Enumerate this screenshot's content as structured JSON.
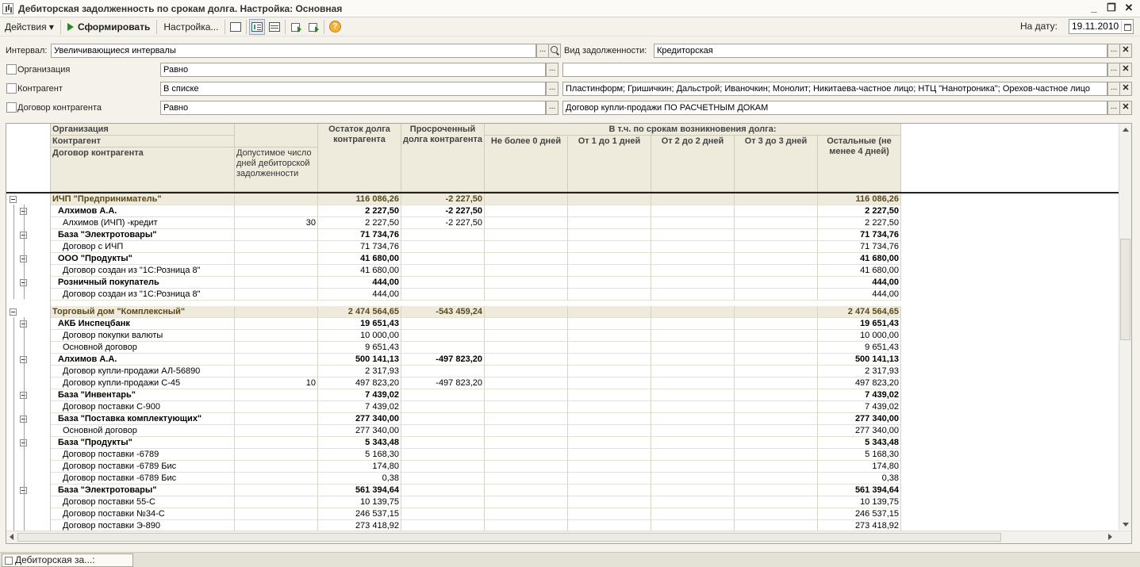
{
  "window": {
    "title": "Дебиторская задолженность по срокам долга. Настройка: Основная",
    "min": "_",
    "restore": "❐",
    "close": "✕"
  },
  "toolbar": {
    "actions": "Действия ▾",
    "generate": "Сформировать",
    "settings": "Настройка...",
    "date_label": "На дату:",
    "date_value": "19.11.2010",
    "help": "?"
  },
  "filters": {
    "interval_label": "Интервал:",
    "interval_value": "Увеличивающиеся интервалы",
    "debt_type_label": "Вид задолженности:",
    "debt_type_value": "Кредиторская",
    "org_label": "Организация",
    "org_cond": "Равно",
    "org_value": "",
    "contractor_label": "Контрагент",
    "contractor_cond": "В списке",
    "contractor_value": "Пластинформ; Гришичкин; Дальстрой; Иваночкин; Монолит; Никитаева-частное лицо; НТЦ \"Нанотроника\"; Орехов-частное лицо",
    "contract_label": "Договор контрагента",
    "contract_cond": "Равно",
    "contract_value": "Договор купли-продажи ПО РАСЧЕТНЫМ ДОКАМ",
    "ellipsis": "...",
    "clear": "✕"
  },
  "table": {
    "headers": {
      "org": "Организация",
      "contractor": "Контрагент",
      "contract": "Договор контрагента",
      "allowed_days": "Допустимое число дней дебиторской задолженности",
      "balance": "Остаток долга контрагента",
      "overdue": "Просроченный долга контрагента",
      "by_terms": "В т.ч. по срокам возникновения долга:",
      "p0": "Не более 0 дней",
      "p1": "От 1 до 1 дней",
      "p2": "От 2 до 2 дней",
      "p3": "От 3 до 3 дней",
      "rest": "Остальные (не менее 4 дней)"
    },
    "rows": [
      {
        "level": "group",
        "name": "ИЧП \"Предприниматель\"",
        "days": "",
        "balance": "116 086,26",
        "overdue": "-2 227,50",
        "rest": "116 086,26"
      },
      {
        "level": "sub",
        "name": "Алхимов А.А.",
        "days": "",
        "balance": "2 227,50",
        "overdue": "-2 227,50",
        "rest": "2 227,50"
      },
      {
        "level": "leaf",
        "name": "Алхимов (ИЧП) -кредит",
        "days": "30",
        "balance": "2 227,50",
        "overdue": "-2 227,50",
        "rest": "2 227,50"
      },
      {
        "level": "sub",
        "name": "База \"Электротовары\"",
        "days": "",
        "balance": "71 734,76",
        "overdue": "",
        "rest": "71 734,76"
      },
      {
        "level": "leaf",
        "name": "Договор с ИЧП",
        "days": "",
        "balance": "71 734,76",
        "overdue": "",
        "rest": "71 734,76"
      },
      {
        "level": "sub",
        "name": "ООО \"Продукты\"",
        "days": "",
        "balance": "41 680,00",
        "overdue": "",
        "rest": "41 680,00"
      },
      {
        "level": "leaf",
        "name": "Договор создан из \"1С:Розница 8\"",
        "days": "",
        "balance": "41 680,00",
        "overdue": "",
        "rest": "41 680,00"
      },
      {
        "level": "sub",
        "name": "Розничный покупатель",
        "days": "",
        "balance": "444,00",
        "overdue": "",
        "rest": "444,00"
      },
      {
        "level": "leaf",
        "name": "Договор создан из \"1С:Розница 8\"",
        "days": "",
        "balance": "444,00",
        "overdue": "",
        "rest": "444,00"
      },
      {
        "level": "group",
        "name": "Торговый дом \"Комплексный\"",
        "days": "",
        "balance": "2 474 564,65",
        "overdue": "-543 459,24",
        "rest": "2 474 564,65"
      },
      {
        "level": "sub",
        "name": "АКБ Инспецбанк",
        "days": "",
        "balance": "19 651,43",
        "overdue": "",
        "rest": "19 651,43"
      },
      {
        "level": "leaf",
        "name": "Договор покупки валюты",
        "days": "",
        "balance": "10 000,00",
        "overdue": "",
        "rest": "10 000,00"
      },
      {
        "level": "leaf",
        "name": "Основной договор",
        "days": "",
        "balance": "9 651,43",
        "overdue": "",
        "rest": "9 651,43"
      },
      {
        "level": "sub",
        "name": "Алхимов А.А.",
        "days": "",
        "balance": "500 141,13",
        "overdue": "-497 823,20",
        "rest": "500 141,13"
      },
      {
        "level": "leaf",
        "name": "Договор купли-продажи АЛ-56890",
        "days": "",
        "balance": "2 317,93",
        "overdue": "",
        "rest": "2 317,93"
      },
      {
        "level": "leaf",
        "name": "Договор купли-продажи С-45",
        "days": "10",
        "balance": "497 823,20",
        "overdue": "-497 823,20",
        "rest": "497 823,20"
      },
      {
        "level": "sub",
        "name": "База \"Инвентарь\"",
        "days": "",
        "balance": "7 439,02",
        "overdue": "",
        "rest": "7 439,02"
      },
      {
        "level": "leaf",
        "name": "Договор поставки С-900",
        "days": "",
        "balance": "7 439,02",
        "overdue": "",
        "rest": "7 439,02"
      },
      {
        "level": "sub",
        "name": "База \"Поставка комплектующих\"",
        "days": "",
        "balance": "277 340,00",
        "overdue": "",
        "rest": "277 340,00"
      },
      {
        "level": "leaf",
        "name": "Основной договор",
        "days": "",
        "balance": "277 340,00",
        "overdue": "",
        "rest": "277 340,00"
      },
      {
        "level": "sub",
        "name": "База \"Продукты\"",
        "days": "",
        "balance": "5 343,48",
        "overdue": "",
        "rest": "5 343,48"
      },
      {
        "level": "leaf",
        "name": "Договор поставки -6789",
        "days": "",
        "balance": "5 168,30",
        "overdue": "",
        "rest": "5 168,30"
      },
      {
        "level": "leaf",
        "name": "Договор поставки -6789 Бис",
        "days": "",
        "balance": "174,80",
        "overdue": "",
        "rest": "174,80"
      },
      {
        "level": "leaf",
        "name": "Договор поставки -6789 Бис",
        "days": "",
        "balance": "0,38",
        "overdue": "",
        "rest": "0,38"
      },
      {
        "level": "sub",
        "name": "База \"Электротовары\"",
        "days": "",
        "balance": "561 394,64",
        "overdue": "",
        "rest": "561 394,64"
      },
      {
        "level": "leaf",
        "name": "Договор поставки 55-С",
        "days": "",
        "balance": "10 139,75",
        "overdue": "",
        "rest": "10 139,75"
      },
      {
        "level": "leaf",
        "name": "Договор поставки №34-С",
        "days": "",
        "balance": "246 537,15",
        "overdue": "",
        "rest": "246 537,15"
      },
      {
        "level": "leaf",
        "name": "Договор поставки Э-890",
        "days": "",
        "balance": "273 418,92",
        "overdue": "",
        "rest": "273 418,92"
      }
    ]
  },
  "taskbar": {
    "item": "Дебиторская за...: Основная"
  }
}
